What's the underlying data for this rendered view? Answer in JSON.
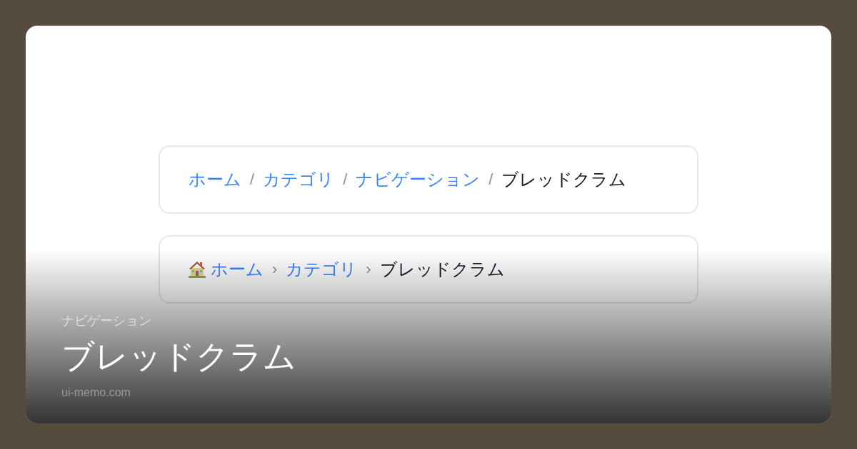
{
  "breadcrumbs": [
    {
      "items": [
        {
          "label": "ホーム",
          "current": false,
          "icon": false,
          "separator": "/"
        },
        {
          "label": "カテゴリ",
          "current": false,
          "icon": false,
          "separator": "/"
        },
        {
          "label": "ナビゲーション",
          "current": false,
          "icon": false,
          "separator": "/"
        },
        {
          "label": "ブレッドクラム",
          "current": true,
          "icon": false
        }
      ]
    },
    {
      "items": [
        {
          "label": "ホーム",
          "current": false,
          "icon": true,
          "separator": "›"
        },
        {
          "label": "カテゴリ",
          "current": false,
          "icon": false,
          "separator": "›"
        },
        {
          "label": "ブレッドクラム",
          "current": true,
          "icon": false
        }
      ]
    }
  ],
  "caption": {
    "category": "ナビゲーション",
    "title": "ブレッドクラム",
    "site": "ui-memo.com"
  }
}
